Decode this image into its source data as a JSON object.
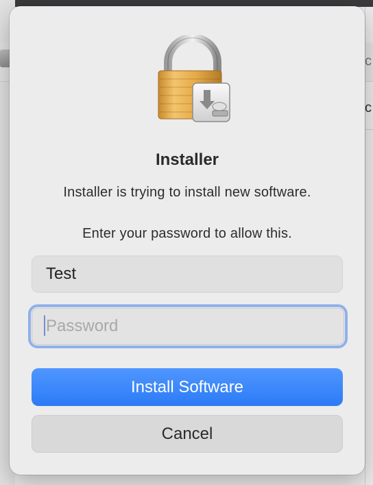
{
  "dialog": {
    "icon": "lock-with-installer-icon",
    "title": "Installer",
    "message_line1": "Installer is trying to install new software.",
    "message_line2": "Enter your password to allow this.",
    "username_value": "Test",
    "password_placeholder": "Password",
    "primary_button": "Install Software",
    "secondary_button": "Cancel"
  },
  "background": {
    "glyph_top": "c",
    "glyph_bottom": "c"
  },
  "colors": {
    "accent": "#2c7bf6",
    "focus_ring": "#8fb0ea",
    "lock_gold": "#e0a84a"
  }
}
